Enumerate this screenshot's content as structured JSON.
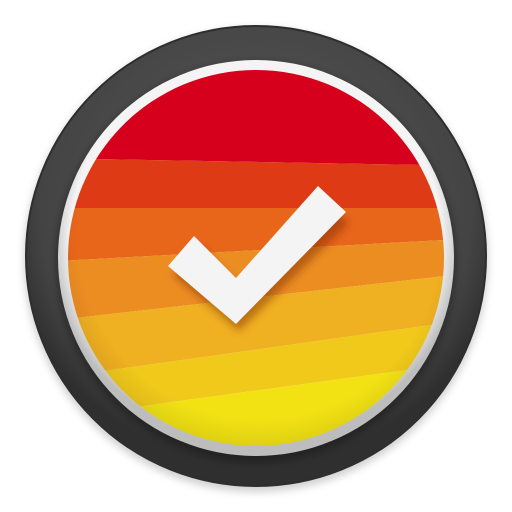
{
  "app_icon": {
    "icon_name": "checkmark-icon",
    "colors": {
      "background": "#ffffff",
      "outer_ring": "#4a4a4a",
      "outer_ring_edge": "#2e2e2e",
      "inner_bezel": "#f2f2f2",
      "checkmark": "#f4f4f4",
      "checkmark_shadow": "#8a3a12"
    },
    "bands": [
      {
        "name": "band-red",
        "color": "#d6001c"
      },
      {
        "name": "band-red-orange",
        "color": "#df3a16"
      },
      {
        "name": "band-orange",
        "color": "#e8661a"
      },
      {
        "name": "band-light-orange",
        "color": "#ec8d22"
      },
      {
        "name": "band-amber",
        "color": "#efb021"
      },
      {
        "name": "band-yellow-orange",
        "color": "#f1c91b"
      },
      {
        "name": "band-yellow",
        "color": "#f2e214"
      }
    ]
  }
}
